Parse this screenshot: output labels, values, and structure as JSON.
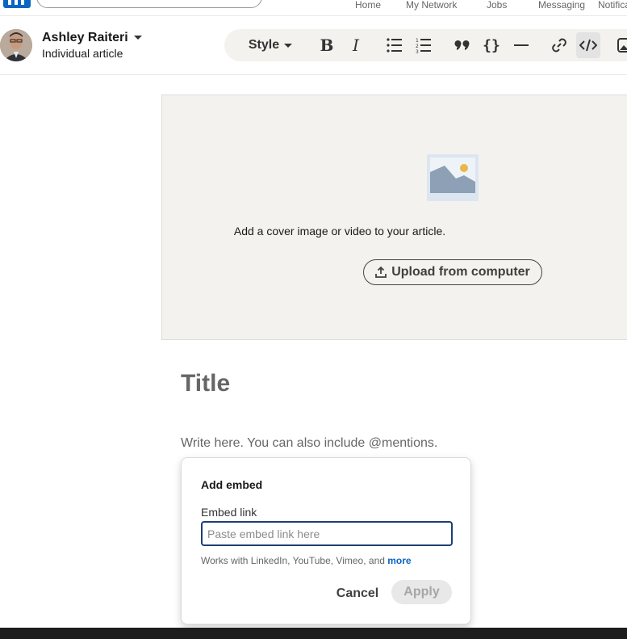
{
  "nav": {
    "links": [
      "Home",
      "My Network",
      "Jobs",
      "Messaging",
      "Notifications"
    ]
  },
  "author": {
    "name": "Ashley Raiteri",
    "subtitle": "Individual article"
  },
  "toolbar": {
    "style_label": "Style",
    "buttons": [
      "bold-icon",
      "italic-icon",
      "bulleted-list-icon",
      "numbered-list-icon",
      "quote-icon",
      "code-block-icon",
      "divider-icon",
      "link-icon",
      "embed-icon",
      "image-icon"
    ],
    "active_button": "embed-icon"
  },
  "cover": {
    "prompt": "Add a cover image or video to your article.",
    "upload_label": "Upload from computer"
  },
  "article": {
    "title_placeholder": "Title",
    "body_placeholder": "Write here. You can also include @mentions."
  },
  "embed_modal": {
    "title": "Add embed",
    "field_label": "Embed link",
    "input_value": "",
    "input_placeholder": "Paste embed link here",
    "help_text": "Works with LinkedIn, YouTube, Vimeo, and ",
    "help_link": "more",
    "cancel_label": "Cancel",
    "apply_label": "Apply"
  },
  "colors": {
    "brand": "#0a66c2",
    "input_focus": "#1c3f73",
    "cover_bg": "#f3f2ef"
  }
}
